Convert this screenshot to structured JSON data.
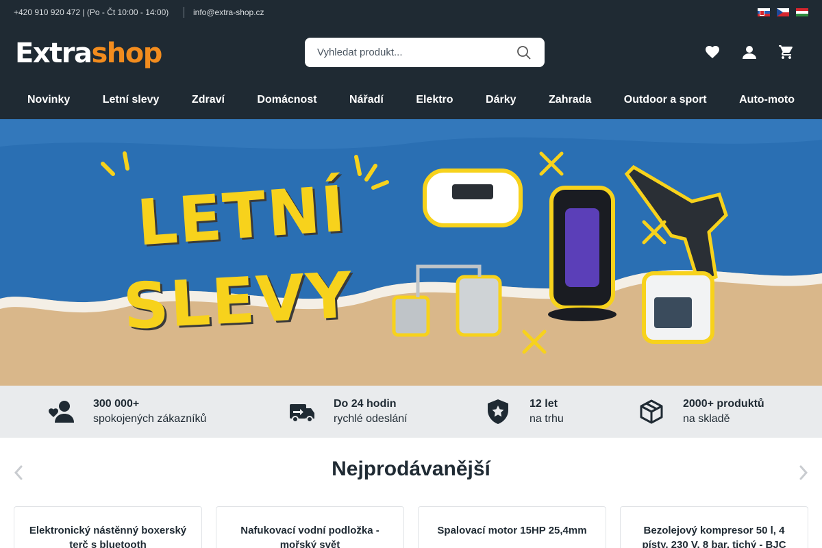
{
  "topbar": {
    "phone": "+420 910 920 472 | (Po - Čt 10:00 - 14:00)",
    "email": "info@extra-shop.cz"
  },
  "header": {
    "logo_part1": "E",
    "logo_part2": "xtra",
    "logo_part3": "shop",
    "search_placeholder": "Vyhledat produkt...",
    "icons": [
      "heart-icon",
      "user-icon",
      "cart-icon"
    ]
  },
  "nav": {
    "items": [
      "Novinky",
      "Letní slevy",
      "Zdraví",
      "Domácnost",
      "Nářadí",
      "Elektro",
      "Dárky",
      "Zahrada",
      "Outdoor a sport",
      "Auto-moto"
    ]
  },
  "hero": {
    "line1": "LETNÍ",
    "line2": "SLEVY",
    "colors": {
      "text": "#f7d21c",
      "sea": "#2a6fb3",
      "sand": "#d9b78a"
    }
  },
  "benefits": [
    {
      "title": "300 000+",
      "subtitle": "spokojených zákazníků",
      "icon": "user-heart-icon"
    },
    {
      "title": "Do 24 hodin",
      "subtitle": "rychlé odeslání",
      "icon": "truck-icon"
    },
    {
      "title": "12 let",
      "subtitle": "na trhu",
      "icon": "shield-star-icon"
    },
    {
      "title": "2000+ produktů",
      "subtitle": "na skladě",
      "icon": "box-icon"
    }
  ],
  "bestsellers": {
    "title": "Nejprodávanější",
    "products": [
      {
        "name": "Elektronický nástěnný boxerský terč s bluetooth"
      },
      {
        "name": "Nafukovací vodní podložka - mořský svět"
      },
      {
        "name": "Spalovací motor 15HP 25,4mm"
      },
      {
        "name": "Bezolejový kompresor 50 l, 4 písty, 230 V, 8 bar, tichý - BJC"
      }
    ]
  },
  "colors": {
    "dark": "#1f2a33",
    "accent": "#f28c1e",
    "benefits_bg": "#e9ebed"
  }
}
